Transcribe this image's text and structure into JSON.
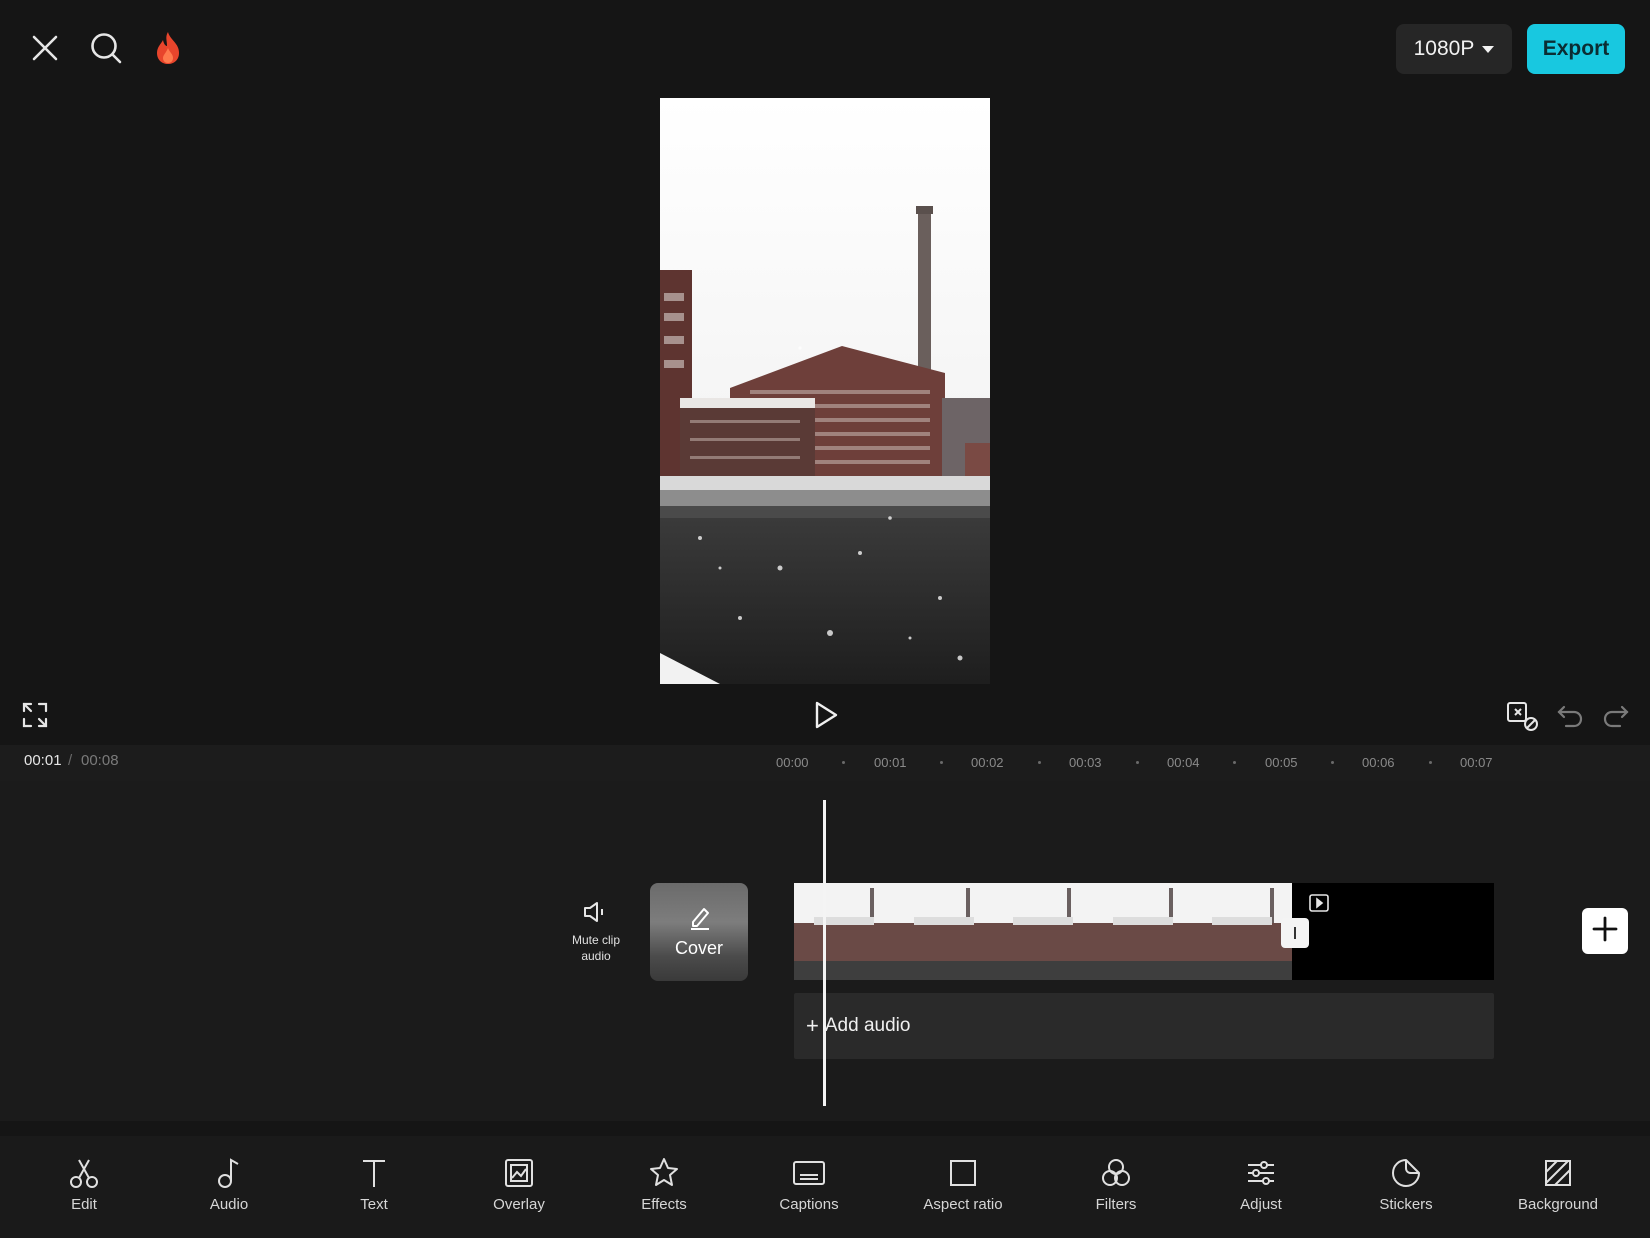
{
  "top_bar": {
    "close_icon": "close-icon",
    "search_icon": "search-icon",
    "trending_icon": "flame-icon",
    "resolution": "1080P",
    "export_label": "Export",
    "export_color": "#18c8e0",
    "flame_color": "#e8452c"
  },
  "player": {
    "current_time": "00:01",
    "separator": "/",
    "total_time": "00:08",
    "fullscreen_icon": "fullscreen-icon",
    "play_icon": "play-icon",
    "keyframe_icon": "keyframe-icon",
    "undo_icon": "undo-icon",
    "redo_icon": "redo-icon"
  },
  "ruler": {
    "ticks": [
      "00:00",
      "00:01",
      "00:02",
      "00:03",
      "00:04",
      "00:05",
      "00:06",
      "00:07"
    ]
  },
  "timeline": {
    "mute_label": "Mute clip audio",
    "cover_label": "Cover",
    "add_audio_label": "Add audio",
    "add_audio_plus": "+"
  },
  "toolbar": {
    "items": [
      {
        "label": "Edit",
        "icon": "scissors-icon"
      },
      {
        "label": "Audio",
        "icon": "music-note-icon"
      },
      {
        "label": "Text",
        "icon": "text-icon"
      },
      {
        "label": "Overlay",
        "icon": "overlay-icon"
      },
      {
        "label": "Effects",
        "icon": "effects-star-icon"
      },
      {
        "label": "Captions",
        "icon": "captions-icon"
      },
      {
        "label": "Aspect ratio",
        "icon": "aspect-ratio-icon"
      },
      {
        "label": "Filters",
        "icon": "filters-icon"
      },
      {
        "label": "Adjust",
        "icon": "adjust-sliders-icon"
      },
      {
        "label": "Stickers",
        "icon": "sticker-icon"
      },
      {
        "label": "Background",
        "icon": "background-icon"
      }
    ]
  }
}
